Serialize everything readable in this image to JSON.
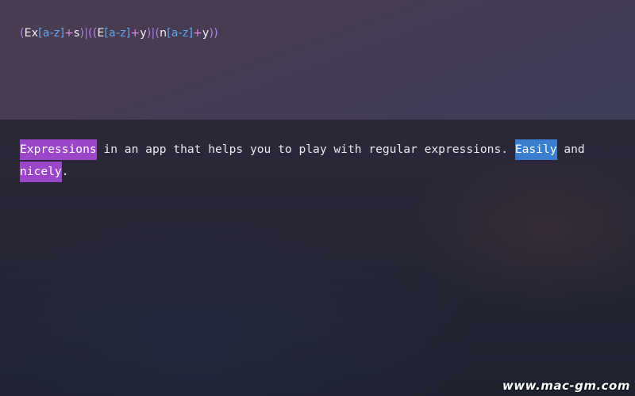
{
  "regex": {
    "tokens": [
      {
        "text": "(",
        "kind": "paren"
      },
      {
        "text": "Ex",
        "kind": "lit"
      },
      {
        "text": "[a-z]",
        "kind": "class"
      },
      {
        "text": "+",
        "kind": "quant"
      },
      {
        "text": "s",
        "kind": "lit"
      },
      {
        "text": ")",
        "kind": "paren"
      },
      {
        "text": "|",
        "kind": "alt"
      },
      {
        "text": "((",
        "kind": "paren"
      },
      {
        "text": "E",
        "kind": "lit"
      },
      {
        "text": "[a-z]",
        "kind": "class"
      },
      {
        "text": "+",
        "kind": "quant"
      },
      {
        "text": "y",
        "kind": "lit"
      },
      {
        "text": ")",
        "kind": "paren"
      },
      {
        "text": "|",
        "kind": "alt"
      },
      {
        "text": "(",
        "kind": "paren"
      },
      {
        "text": "n",
        "kind": "lit"
      },
      {
        "text": "[a-z]",
        "kind": "class"
      },
      {
        "text": "+",
        "kind": "quant"
      },
      {
        "text": "y",
        "kind": "lit"
      },
      {
        "text": "))",
        "kind": "paren"
      }
    ]
  },
  "sample": {
    "segments": [
      {
        "text": "Expressions",
        "match": "purple"
      },
      {
        "text": " in an app that helps you to play with regular expressions. ",
        "match": null
      },
      {
        "text": "Easily",
        "match": "blue"
      },
      {
        "text": " and\n",
        "match": null
      },
      {
        "text": "nicely",
        "match": "purple"
      },
      {
        "text": ".",
        "match": null
      }
    ]
  },
  "colors": {
    "match_purple": "#9b45c9",
    "match_blue": "#3a7fcf",
    "regex_class": "#5fa6f0",
    "regex_paren": "#b084e8"
  },
  "watermark": "www.mac-gm.com"
}
